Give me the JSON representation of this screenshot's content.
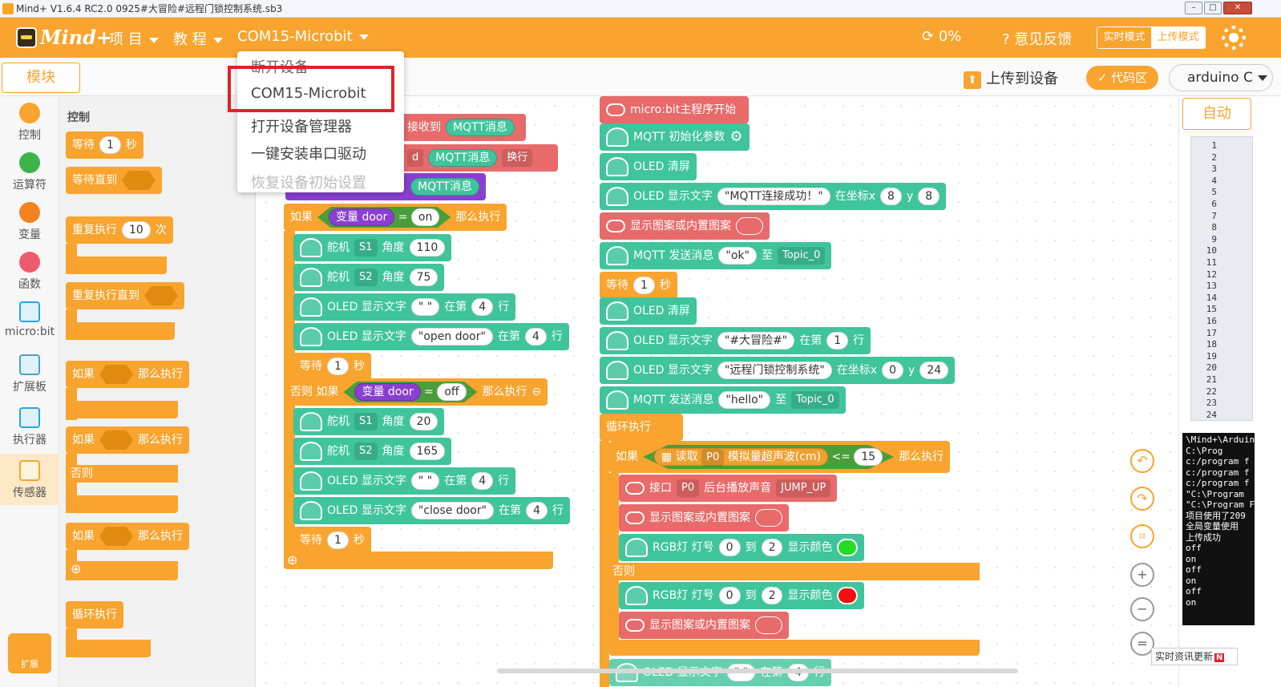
{
  "titlebar": {
    "title": "Mind+ V1.6.4 RC2.0   0925#大冒险#远程门锁控制系统.sb3",
    "min": "–",
    "max": "□",
    "close": "✕"
  },
  "menubar": {
    "brand": "Mind+",
    "project": "项 目",
    "tutorial": "教 程",
    "device": "COM15-Microbit",
    "progress": "0%",
    "feedback": "意见反馈",
    "mode_realtime": "实时模式",
    "mode_upload": "上传模式"
  },
  "toolbar": {
    "blocks_tab": "模块",
    "upload": "上传到设备",
    "code_area": "代码区",
    "board": "arduino C"
  },
  "device_menu": {
    "items": [
      "断开设备",
      "COM15-Microbit",
      "打开设备管理器",
      "一键安装串口驱动",
      "恢复设备初始设置"
    ]
  },
  "categories": [
    {
      "label": "控制",
      "color": "#f8a42e"
    },
    {
      "label": "运算符",
      "color": "#3cb44a"
    },
    {
      "label": "变量",
      "color": "#f58220"
    },
    {
      "label": "函数",
      "color": "#ee5a6e"
    },
    {
      "label": "micro:bit"
    },
    {
      "label": "扩展板"
    },
    {
      "label": "执行器"
    },
    {
      "label": "传感器"
    }
  ],
  "ext_label": "扩展",
  "flyout": {
    "title": "控制",
    "wait": "等待",
    "wait_n": "1",
    "sec": "秒",
    "wait_until": "等待直到",
    "repeat": "重复执行",
    "repeat_n": "10",
    "times": "次",
    "repeat_until": "重复执行直到",
    "if": "如果",
    "then": "那么执行",
    "else": "否则",
    "forever": "循环执行"
  },
  "script_left": {
    "recv": "接收到",
    "mqtt_msg": "MQTT消息",
    "recv2_dd": "d",
    "mqtt_msg2": "MQTT消息",
    "newline": "换行",
    "mqtt_msg3": "MQTT消息",
    "if": "如果",
    "var_door": "变量 door",
    "eq": "=",
    "on": "on",
    "then": "那么执行",
    "servo": "舵机",
    "s1": "S1",
    "s2": "S2",
    "angle": "角度",
    "a110": "110",
    "a75": "75",
    "a20": "20",
    "a165": "165",
    "oled_text": "OLED 显示文字",
    "empty_str": "\" \"",
    "open_door": "\"open door\"",
    "close_door": "\"close door\"",
    "at_line": "在第",
    "line4": "4",
    "row": "行",
    "wait": "等待",
    "one": "1",
    "sec": "秒",
    "elseif": "否则 如果",
    "off": "off"
  },
  "script_right": {
    "main_start": "micro:bit主程序开始",
    "mqtt_init": "MQTT 初始化参数",
    "oled_clear": "OLED 清屏",
    "oled_text": "OLED 显示文字",
    "mqtt_ok": "\"MQTT连接成功！\"",
    "at_coord": "在坐标x",
    "y": "y",
    "x8": "8",
    "y8": "8",
    "show_pattern": "显示图案或内置图案",
    "mqtt_send": "MQTT 发送消息",
    "ok": "\"ok\"",
    "to": "至",
    "topic0": "Topic_0",
    "wait": "等待",
    "one": "1",
    "sec": "秒",
    "adventure": "\"#大冒险#\"",
    "at_line": "在第",
    "line1": "1",
    "row": "行",
    "lock_sys": "\"远程门锁控制系统\"",
    "x0": "0",
    "y24": "24",
    "hello": "\"hello\"",
    "forever": "循环执行",
    "if": "如果",
    "read": "读取",
    "p0": "P0",
    "ultra": "模拟量超声波(cm)",
    "le": "<=",
    "n15": "15",
    "then": "那么执行",
    "pin": "接口",
    "bg_sound": "后台播放声音",
    "jump_up": "JUMP_UP",
    "rgb": "RGB灯 灯号",
    "n0": "0",
    "to_word": "到",
    "n2": "2",
    "show_color": "显示颜色",
    "else": "否则",
    "oled_bottom": "OLED 显示文字",
    "str_q": "\" \"",
    "n4": "4"
  },
  "right_panel": {
    "tab": "自动",
    "line_numbers": [
      "1",
      "2",
      "3",
      "4",
      "5",
      "6",
      "7",
      "8",
      "9",
      "10",
      "11",
      "12",
      "13",
      "14",
      "15",
      "16",
      "17",
      "18",
      "19",
      "20",
      "21",
      "22",
      "23",
      "24"
    ],
    "console": [
      "\\Mind+\\Arduin",
      "C:\\Prog",
      "c:/program f",
      "c:/program f",
      "c:/program f",
      "\"C:\\Program",
      "\"C:\\Program F",
      "项目使用了209",
      "全局变量使用",
      "上传成功",
      "off",
      "on",
      "off",
      "on",
      "off",
      "on"
    ],
    "news": "实时资讯更新",
    "news_badge": "N"
  },
  "colors": {
    "accent": "#f8a42e",
    "microbit": "#3fc49b",
    "event": "#e86a6a",
    "variable": "#8a3fd1",
    "operator": "#5dbb4a",
    "led_green": "#22dd22",
    "led_red": "#ee1111"
  }
}
